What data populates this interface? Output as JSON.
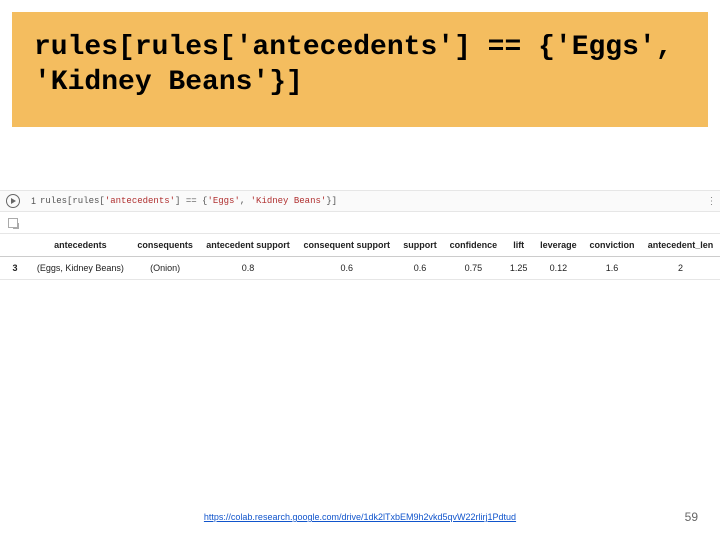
{
  "title": "rules[rules['antecedents'] == {'Eggs', 'Kidney Beans'}]",
  "cell": {
    "num": "1",
    "code_prefix": "rules[rules[",
    "code_s1": "'antecedents'",
    "code_mid": "] == {",
    "code_s2": "'Eggs'",
    "code_sep": ", ",
    "code_s3": "'Kidney Beans'",
    "code_suffix": "}]"
  },
  "headers": [
    "",
    "antecedents",
    "consequents",
    "antecedent support",
    "consequent support",
    "support",
    "confidence",
    "lift",
    "leverage",
    "conviction",
    "antecedent_len"
  ],
  "row": {
    "idx": "3",
    "antecedents": "(Eggs, Kidney Beans)",
    "consequents": "(Onion)",
    "ant_support": "0.8",
    "con_support": "0.6",
    "support": "0.6",
    "confidence": "0.75",
    "lift": "1.25",
    "leverage": "0.12",
    "conviction": "1.6",
    "ant_len": "2"
  },
  "link": {
    "text": "https://colab.research.google.com/drive/1dk2lTxbEM9h2vkd5qvW22rlirj1Pdtud",
    "href": "https://colab.research.google.com/drive/1dk2lTxbEM9h2vkd5qvW22rlirj1Pdtud"
  },
  "page_num": "59"
}
